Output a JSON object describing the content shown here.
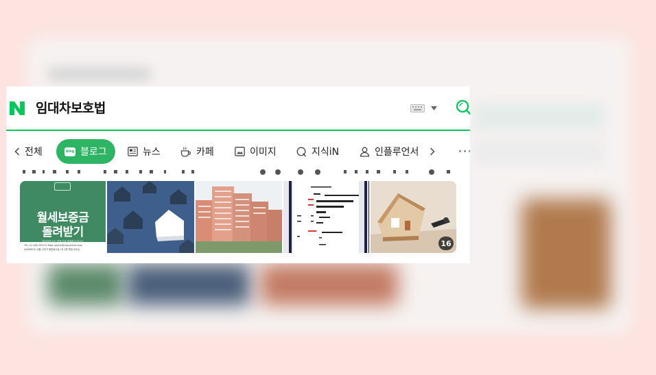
{
  "search": {
    "query": "임대차보호법"
  },
  "tabs": [
    {
      "label": "전체",
      "icon": "chevron-left-icon"
    },
    {
      "label": "블로그",
      "icon": "blog-icon",
      "badge": "blog",
      "active": true
    },
    {
      "label": "뉴스",
      "icon": "news-icon"
    },
    {
      "label": "카페",
      "icon": "cafe-icon"
    },
    {
      "label": "이미지",
      "icon": "image-icon"
    },
    {
      "label": "지식iN",
      "icon": "q-icon"
    },
    {
      "label": "인플루언서",
      "icon": "person-icon"
    }
  ],
  "thumbnails": {
    "tile1": {
      "headline1": "월세보증금",
      "headline2": "돌려받기",
      "small_line": "법유경에 있는 법에 따라 해결해 드립니다",
      "footer1": "TEL 02-586-3902 E-MAIL admin@lawyerhee.com",
      "footer2": "ADDRESS 서울 서초구 법원로3길 16 2층 변호사무실"
    },
    "tile5_count": "16"
  },
  "colors": {
    "brand_green": "#03c75a",
    "active_tab": "#2db564",
    "background": "#fde4e0"
  }
}
